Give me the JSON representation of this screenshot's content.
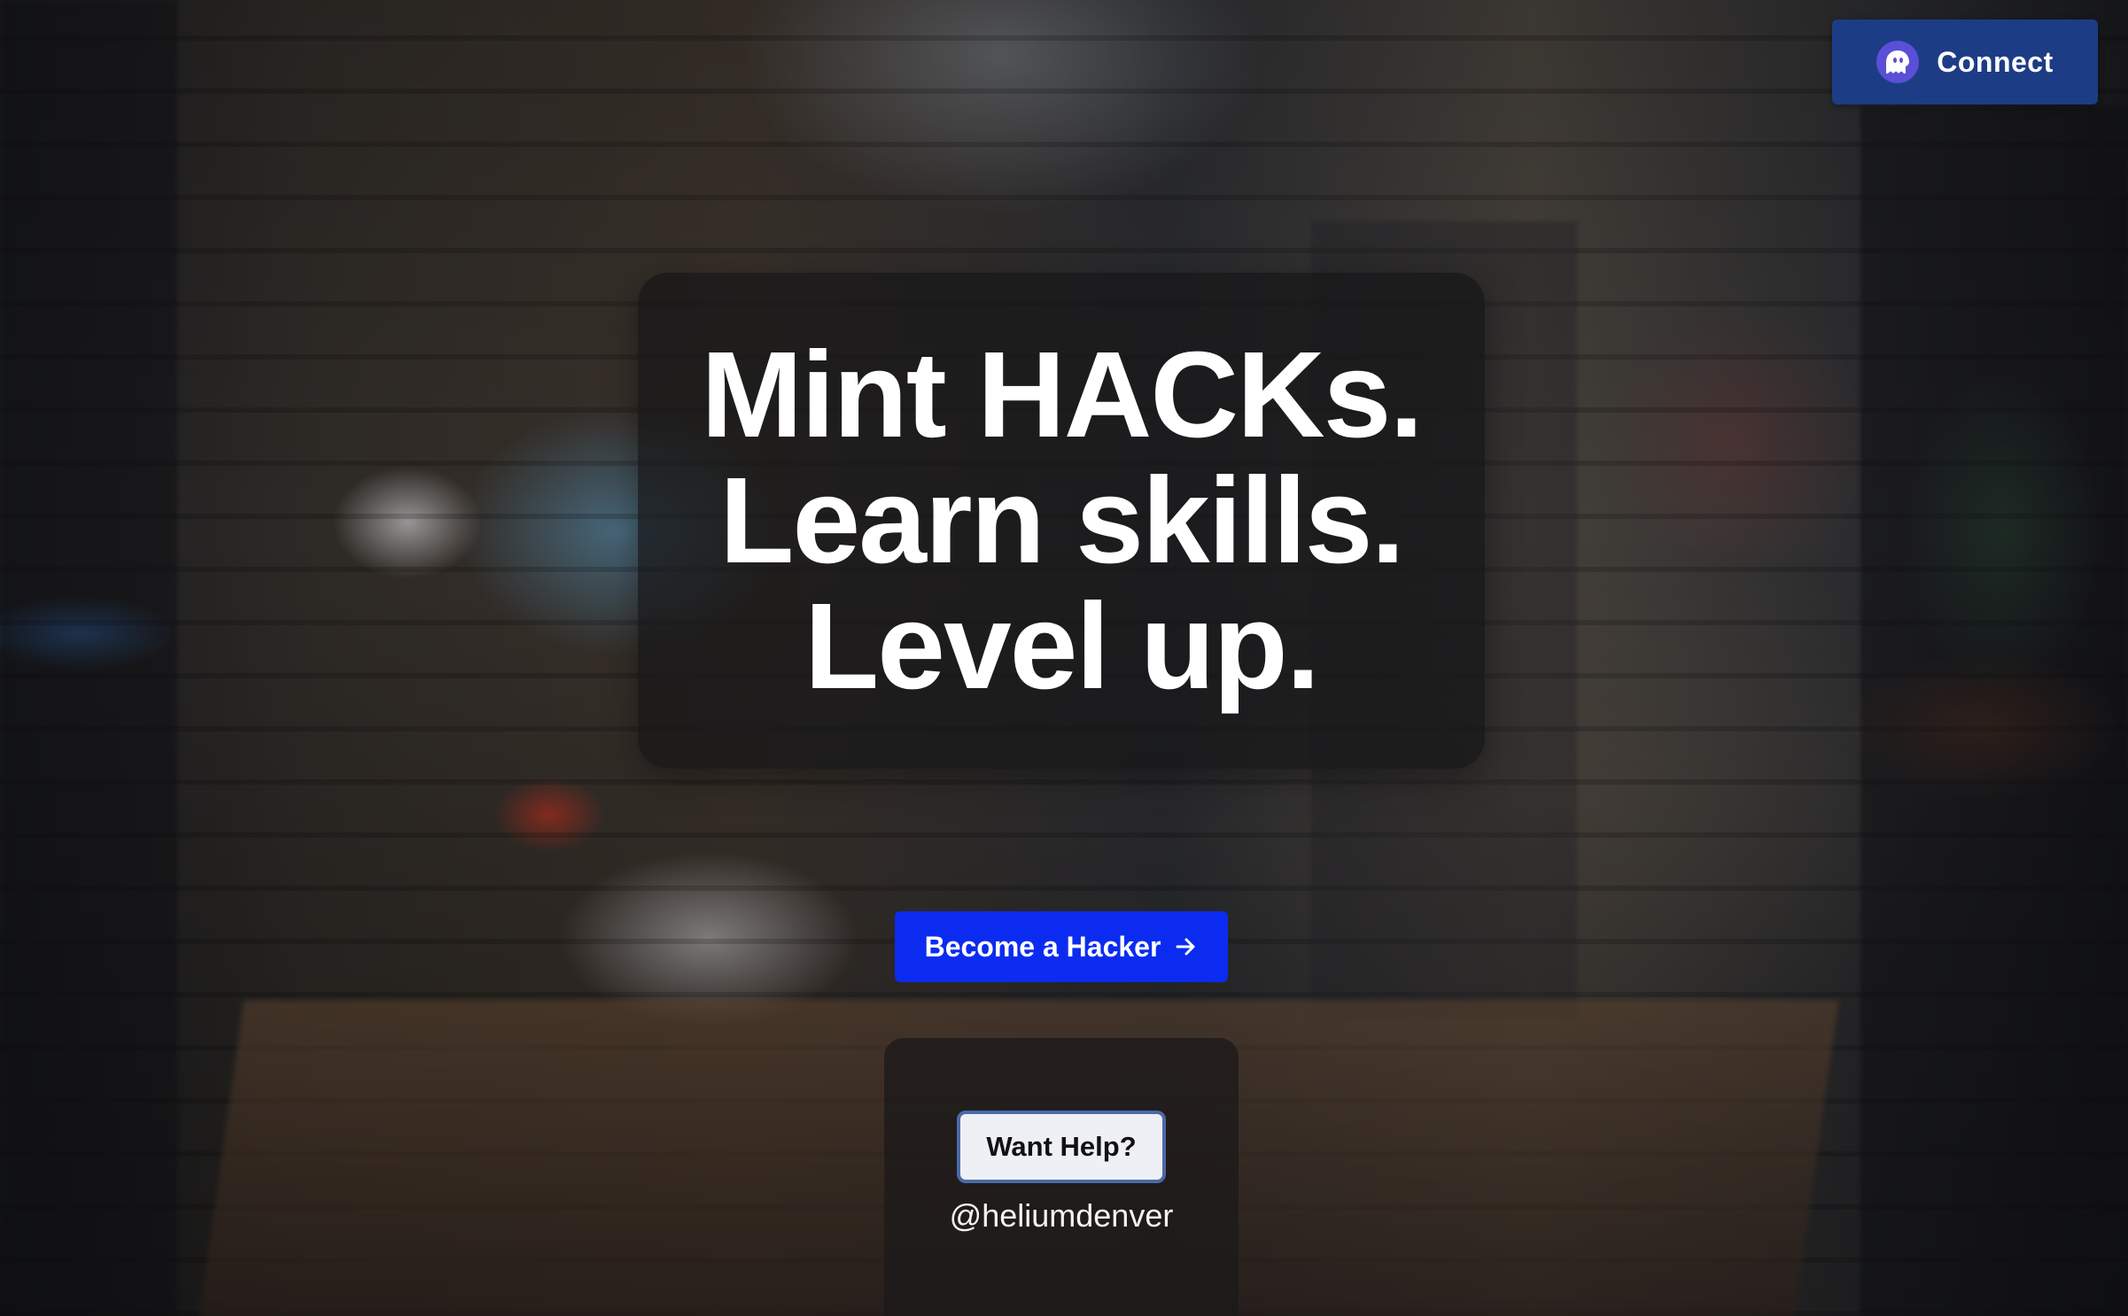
{
  "header": {
    "connect_label": "Connect",
    "connect_icon": "phantom-ghost-icon"
  },
  "hero": {
    "lines": [
      "Mint HACKs.",
      "Learn skills.",
      "Level up."
    ]
  },
  "cta": {
    "label": "Become a Hacker",
    "icon": "arrow-right-icon",
    "color": "#0b2cf0"
  },
  "help": {
    "button_label": "Want Help?",
    "handle": "@heliumdenver"
  },
  "colors": {
    "connect_bg": "#1d3c86",
    "connect_icon_bg": "#5a4fd6",
    "help_button_bg": "#eef0f6",
    "help_button_border": "#4a6aa8"
  }
}
